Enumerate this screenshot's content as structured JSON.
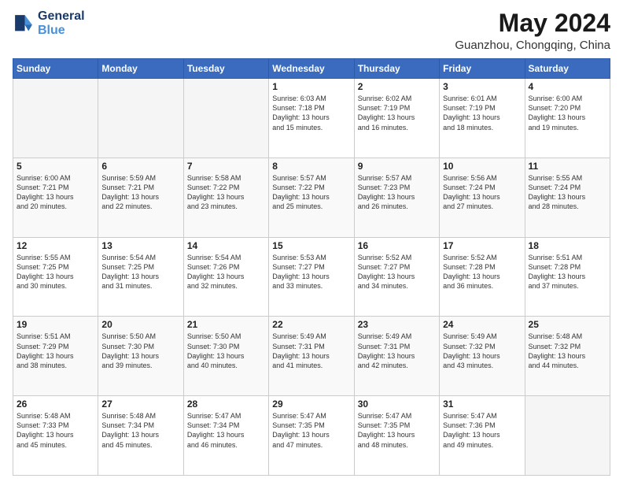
{
  "header": {
    "logo_line1": "General",
    "logo_line2": "Blue",
    "month_title": "May 2024",
    "location": "Guanzhou, Chongqing, China"
  },
  "weekdays": [
    "Sunday",
    "Monday",
    "Tuesday",
    "Wednesday",
    "Thursday",
    "Friday",
    "Saturday"
  ],
  "weeks": [
    [
      {
        "day": "",
        "info": ""
      },
      {
        "day": "",
        "info": ""
      },
      {
        "day": "",
        "info": ""
      },
      {
        "day": "1",
        "info": "Sunrise: 6:03 AM\nSunset: 7:18 PM\nDaylight: 13 hours\nand 15 minutes."
      },
      {
        "day": "2",
        "info": "Sunrise: 6:02 AM\nSunset: 7:19 PM\nDaylight: 13 hours\nand 16 minutes."
      },
      {
        "day": "3",
        "info": "Sunrise: 6:01 AM\nSunset: 7:19 PM\nDaylight: 13 hours\nand 18 minutes."
      },
      {
        "day": "4",
        "info": "Sunrise: 6:00 AM\nSunset: 7:20 PM\nDaylight: 13 hours\nand 19 minutes."
      }
    ],
    [
      {
        "day": "5",
        "info": "Sunrise: 6:00 AM\nSunset: 7:21 PM\nDaylight: 13 hours\nand 20 minutes."
      },
      {
        "day": "6",
        "info": "Sunrise: 5:59 AM\nSunset: 7:21 PM\nDaylight: 13 hours\nand 22 minutes."
      },
      {
        "day": "7",
        "info": "Sunrise: 5:58 AM\nSunset: 7:22 PM\nDaylight: 13 hours\nand 23 minutes."
      },
      {
        "day": "8",
        "info": "Sunrise: 5:57 AM\nSunset: 7:22 PM\nDaylight: 13 hours\nand 25 minutes."
      },
      {
        "day": "9",
        "info": "Sunrise: 5:57 AM\nSunset: 7:23 PM\nDaylight: 13 hours\nand 26 minutes."
      },
      {
        "day": "10",
        "info": "Sunrise: 5:56 AM\nSunset: 7:24 PM\nDaylight: 13 hours\nand 27 minutes."
      },
      {
        "day": "11",
        "info": "Sunrise: 5:55 AM\nSunset: 7:24 PM\nDaylight: 13 hours\nand 28 minutes."
      }
    ],
    [
      {
        "day": "12",
        "info": "Sunrise: 5:55 AM\nSunset: 7:25 PM\nDaylight: 13 hours\nand 30 minutes."
      },
      {
        "day": "13",
        "info": "Sunrise: 5:54 AM\nSunset: 7:25 PM\nDaylight: 13 hours\nand 31 minutes."
      },
      {
        "day": "14",
        "info": "Sunrise: 5:54 AM\nSunset: 7:26 PM\nDaylight: 13 hours\nand 32 minutes."
      },
      {
        "day": "15",
        "info": "Sunrise: 5:53 AM\nSunset: 7:27 PM\nDaylight: 13 hours\nand 33 minutes."
      },
      {
        "day": "16",
        "info": "Sunrise: 5:52 AM\nSunset: 7:27 PM\nDaylight: 13 hours\nand 34 minutes."
      },
      {
        "day": "17",
        "info": "Sunrise: 5:52 AM\nSunset: 7:28 PM\nDaylight: 13 hours\nand 36 minutes."
      },
      {
        "day": "18",
        "info": "Sunrise: 5:51 AM\nSunset: 7:28 PM\nDaylight: 13 hours\nand 37 minutes."
      }
    ],
    [
      {
        "day": "19",
        "info": "Sunrise: 5:51 AM\nSunset: 7:29 PM\nDaylight: 13 hours\nand 38 minutes."
      },
      {
        "day": "20",
        "info": "Sunrise: 5:50 AM\nSunset: 7:30 PM\nDaylight: 13 hours\nand 39 minutes."
      },
      {
        "day": "21",
        "info": "Sunrise: 5:50 AM\nSunset: 7:30 PM\nDaylight: 13 hours\nand 40 minutes."
      },
      {
        "day": "22",
        "info": "Sunrise: 5:49 AM\nSunset: 7:31 PM\nDaylight: 13 hours\nand 41 minutes."
      },
      {
        "day": "23",
        "info": "Sunrise: 5:49 AM\nSunset: 7:31 PM\nDaylight: 13 hours\nand 42 minutes."
      },
      {
        "day": "24",
        "info": "Sunrise: 5:49 AM\nSunset: 7:32 PM\nDaylight: 13 hours\nand 43 minutes."
      },
      {
        "day": "25",
        "info": "Sunrise: 5:48 AM\nSunset: 7:32 PM\nDaylight: 13 hours\nand 44 minutes."
      }
    ],
    [
      {
        "day": "26",
        "info": "Sunrise: 5:48 AM\nSunset: 7:33 PM\nDaylight: 13 hours\nand 45 minutes."
      },
      {
        "day": "27",
        "info": "Sunrise: 5:48 AM\nSunset: 7:34 PM\nDaylight: 13 hours\nand 45 minutes."
      },
      {
        "day": "28",
        "info": "Sunrise: 5:47 AM\nSunset: 7:34 PM\nDaylight: 13 hours\nand 46 minutes."
      },
      {
        "day": "29",
        "info": "Sunrise: 5:47 AM\nSunset: 7:35 PM\nDaylight: 13 hours\nand 47 minutes."
      },
      {
        "day": "30",
        "info": "Sunrise: 5:47 AM\nSunset: 7:35 PM\nDaylight: 13 hours\nand 48 minutes."
      },
      {
        "day": "31",
        "info": "Sunrise: 5:47 AM\nSunset: 7:36 PM\nDaylight: 13 hours\nand 49 minutes."
      },
      {
        "day": "",
        "info": ""
      }
    ]
  ]
}
